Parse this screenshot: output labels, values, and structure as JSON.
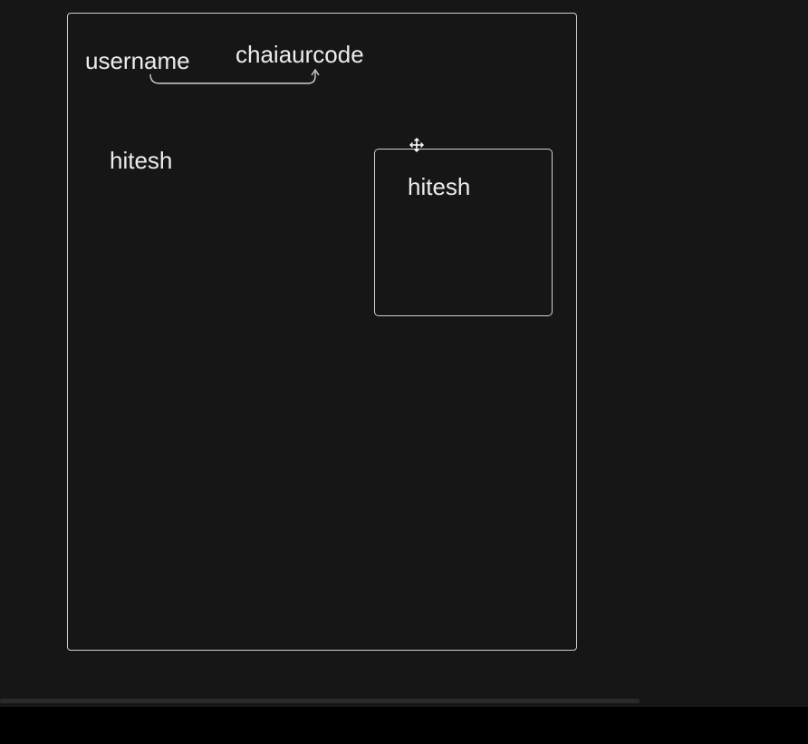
{
  "diagram": {
    "variable_name": "username",
    "variable_value": "chaiaurcode",
    "copy_a": "hitesh",
    "copy_b": "hitesh"
  },
  "colors": {
    "background": "#161616",
    "stroke": "#cfcfcf",
    "text": "#ececec"
  },
  "icons": {
    "cursor": "move-cursor-icon"
  }
}
